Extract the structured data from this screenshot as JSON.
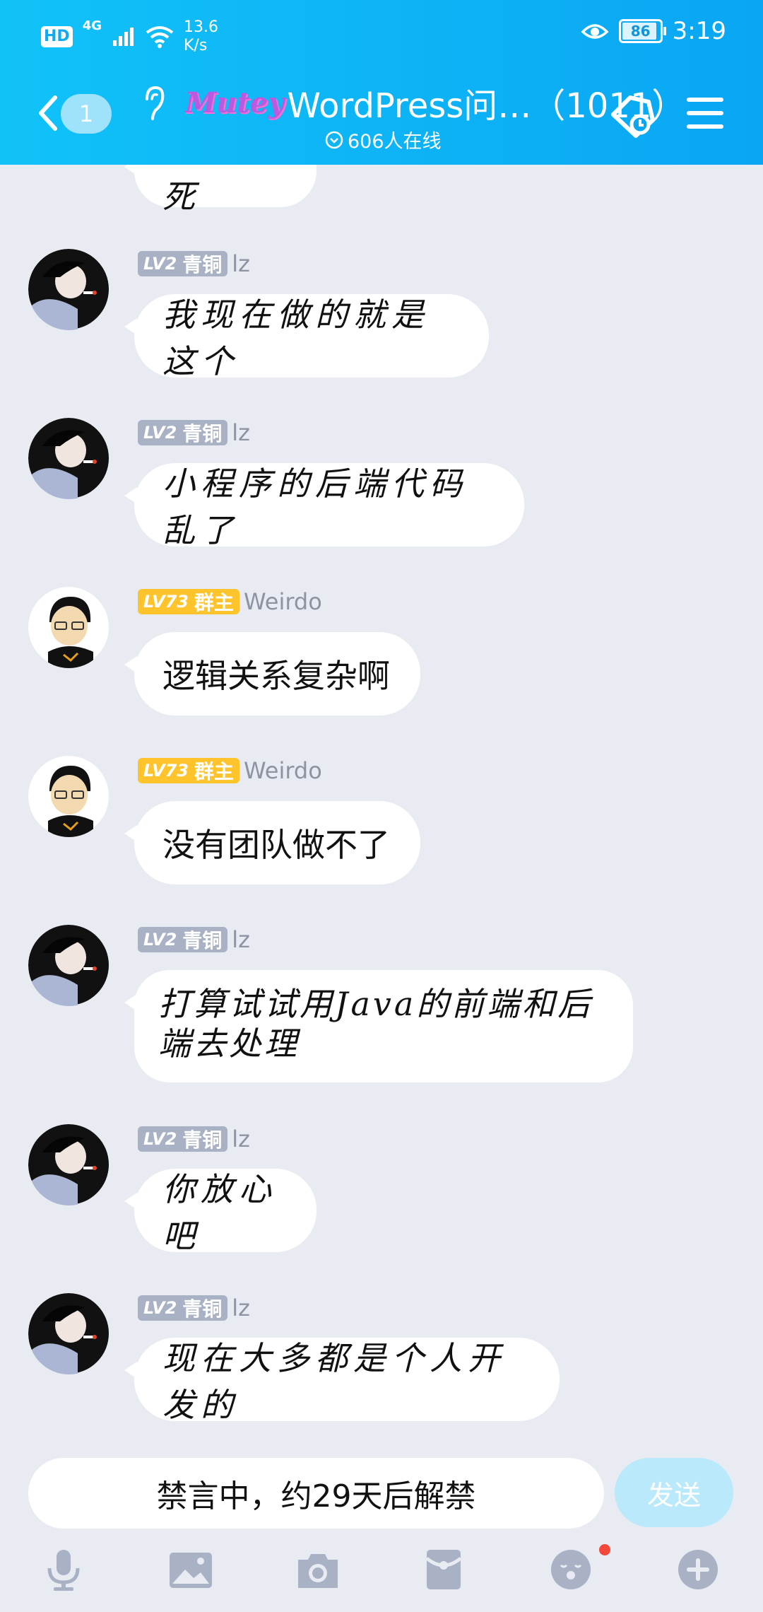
{
  "status": {
    "hd": "HD",
    "network": "4G",
    "netspeed_value": "13.6",
    "netspeed_unit": "K/s",
    "battery": "86",
    "time": "3:19"
  },
  "header": {
    "back_count": "1",
    "logo_text": "Mutey",
    "title": "WordPress问…（1011）",
    "online": "606人在线"
  },
  "colors": {
    "header": "#0aa6f3",
    "background": "#e9ebf3",
    "bronze_tag": "#a9b1c4",
    "owner_tag": "#ffc42b",
    "send_button": "#b9e9fb"
  },
  "messages": [
    {
      "text": "这种贡死"
    },
    {
      "lv": "LV2",
      "rank": "青铜",
      "user": "lz",
      "text": "我现在做的就是这个"
    },
    {
      "lv": "LV2",
      "rank": "青铜",
      "user": "lz",
      "text": "小程序的后端代码乱了"
    },
    {
      "lv": "LV73",
      "rank": "群主",
      "user": "Weirdo",
      "text": "逻辑关系复杂啊"
    },
    {
      "lv": "LV73",
      "rank": "群主",
      "user": "Weirdo",
      "text": "没有团队做不了"
    },
    {
      "lv": "LV2",
      "rank": "青铜",
      "user": "lz",
      "text": "打算试试用Java的前端和后端去处理"
    },
    {
      "lv": "LV2",
      "rank": "青铜",
      "user": "lz",
      "text": "你放心吧"
    },
    {
      "lv": "LV2",
      "rank": "青铜",
      "user": "lz",
      "text": "现在大多都是个人开发的"
    }
  ],
  "input": {
    "placeholder": "禁言中，约29天后解禁",
    "send_label": "发送"
  },
  "toolbar": [
    "mic-icon",
    "image-icon",
    "camera-icon",
    "red-packet-icon",
    "emoji-icon",
    "plus-icon"
  ]
}
